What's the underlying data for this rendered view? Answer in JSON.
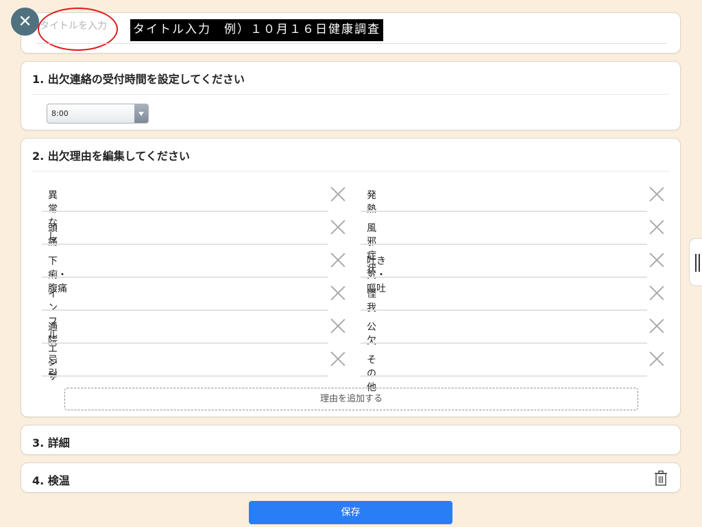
{
  "title_section": {
    "placeholder": "タイトルを入力",
    "hint": "タイトル入力　例）１０月１６日健康調査"
  },
  "sections": [
    {
      "title": "1. 出欠連絡の受付時間を設定してください"
    },
    {
      "title": "2. 出欠理由を編集してください"
    },
    {
      "title": "3. 詳細"
    },
    {
      "title": "4. 検温"
    }
  ],
  "time_select": {
    "value": "8:00"
  },
  "reasons": {
    "left": [
      "異常なし",
      "頭痛",
      "下痢・腹痛",
      "インフルエンザ",
      "通院",
      "忌引"
    ],
    "right": [
      "発熱",
      "風邪症状",
      "吐き気・嘔吐",
      "怪我",
      "公欠",
      "その他"
    ]
  },
  "add_reason_label": "理由を追加する",
  "save_label": "保存",
  "icons": {
    "close": "close-icon",
    "delete": "close-icon",
    "trash": "trash-icon",
    "dropdown": "chevron-down-icon",
    "handle": "drag-handle-icon"
  },
  "colors": {
    "background": "#fbeedc",
    "close_button": "#4f7180",
    "save_button": "#2a7ef5",
    "highlight_ring": "#e01818"
  }
}
